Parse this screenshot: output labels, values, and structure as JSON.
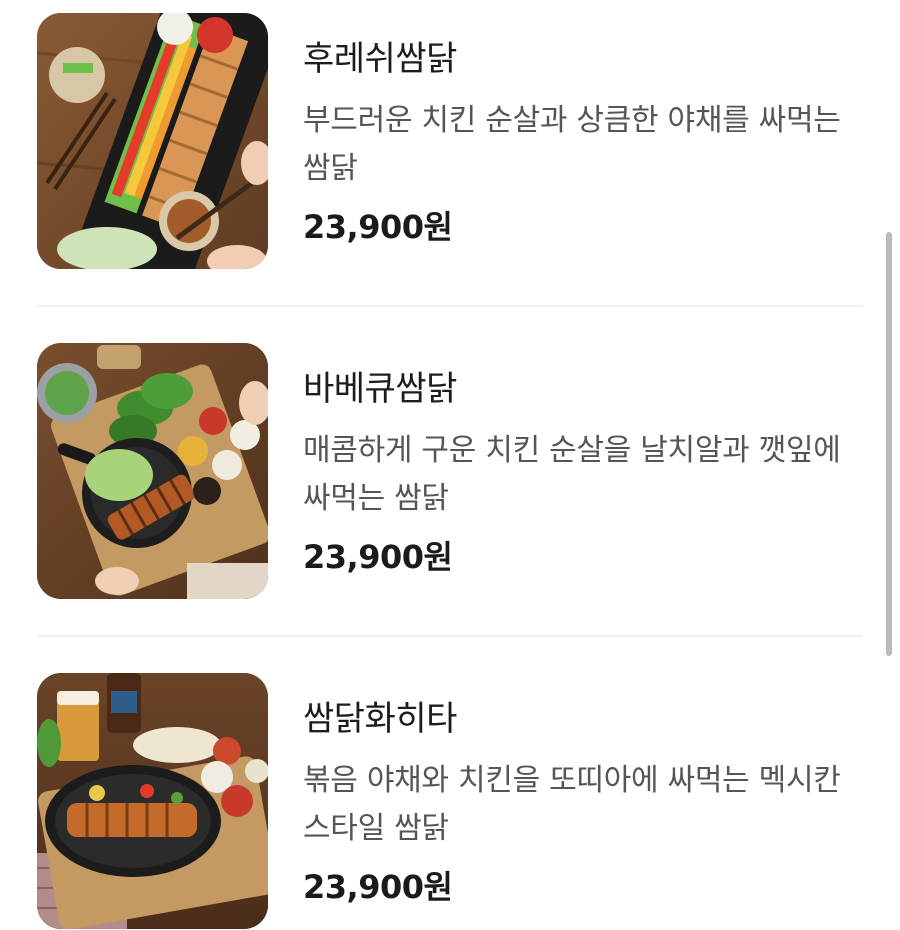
{
  "menu": {
    "items": [
      {
        "name": "후레쉬쌈닭",
        "description": "부드러운 치킨 순살과 상큼한 야채를 싸먹는 쌈닭",
        "price": "23,900원",
        "image_icon": "fresh-ssamdak-photo"
      },
      {
        "name": "바베큐쌈닭",
        "description": "매콤하게 구운 치킨 순살을 날치알과 깻잎에 싸먹는 쌈닭",
        "price": "23,900원",
        "image_icon": "bbq-ssamdak-photo"
      },
      {
        "name": "쌈닭화히타",
        "description": "볶음 야채와 치킨을 또띠아에 싸먹는 멕시칸 스타일 쌈닭",
        "price": "23,900원",
        "image_icon": "fajita-ssamdak-photo"
      }
    ]
  },
  "colors": {
    "text_primary": "#1c1c1c",
    "text_secondary": "#555555",
    "divider": "#f0f0f0",
    "scrollbar": "#b9b9b9"
  }
}
